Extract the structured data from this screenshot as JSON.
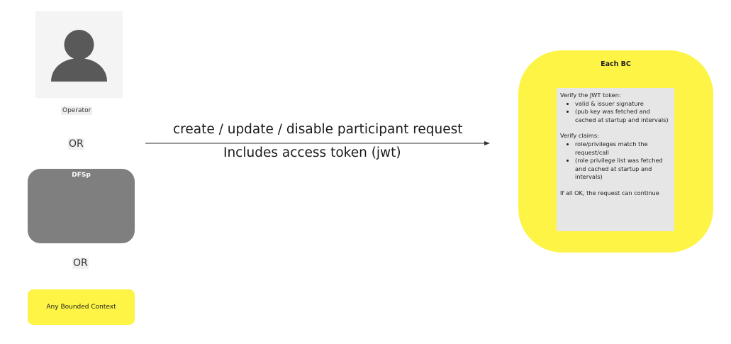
{
  "actors": {
    "operator_label": "Operator",
    "or_1": "OR",
    "dfsp_label": "DFSp",
    "or_2": "OR",
    "bounded_context_label": "Any Bounded Context"
  },
  "arrow": {
    "request_label": "create / update / disable participant request",
    "token_label": "Includes access token (jwt)"
  },
  "bc": {
    "title": "Each BC",
    "verify_token_heading": "Verify the JWT token:",
    "verify_token_items": [
      "valid & issuer signature",
      "(pub key was fetched and cached at startup and intervals)"
    ],
    "verify_claims_heading": "Verify claims:",
    "verify_claims_items": [
      "role/privileges match the request/call",
      "(role privilege list was fetched and cached at startup and intervals)"
    ],
    "conclusion": "If all OK, the request can continue"
  },
  "colors": {
    "sticky_yellow": "#fef445",
    "dfsp_gray": "#7f7f7f",
    "note_gray": "#e6e6e6"
  },
  "icons": {
    "operator": "user-avatar-icon",
    "arrow": "arrow-right-icon"
  }
}
